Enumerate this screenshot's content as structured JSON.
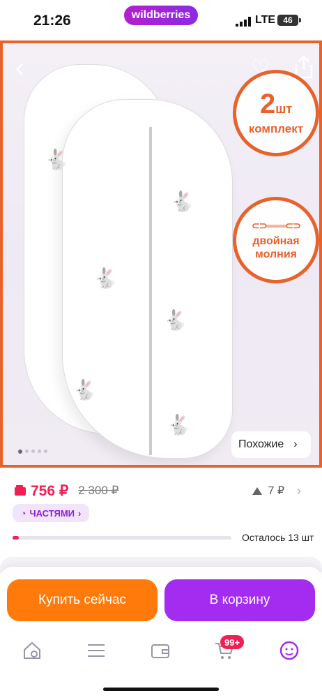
{
  "status_bar": {
    "time": "21:26",
    "brand": "wildberries",
    "network": "LTE",
    "battery": "46"
  },
  "gallery": {
    "badge_set": {
      "number": "2",
      "unit": "шт",
      "label": "комплект"
    },
    "badge_zip": {
      "label": "двойная молния"
    },
    "similar_button": "Похожие",
    "dots_count": 5,
    "active_dot": 0
  },
  "price": {
    "current": "756 ₽",
    "old": "2 300 ₽",
    "rating_value": "7 ₽"
  },
  "installments": {
    "label": "ЧАСТЯМИ"
  },
  "stock": {
    "text": "Осталось 13 шт",
    "level_percent": 3
  },
  "actions": {
    "buy_now": "Купить сейчас",
    "to_cart": "В корзину"
  },
  "tabbar": {
    "cart_badge": "99+"
  },
  "colors": {
    "accent_orange": "#e8622b",
    "price_red": "#f01f54",
    "purple": "#a32cf0",
    "buy_orange": "#ff7a0a"
  }
}
